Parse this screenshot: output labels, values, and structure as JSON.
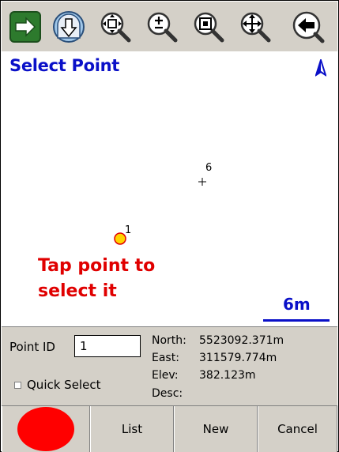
{
  "toolbar": {
    "buttons": [
      {
        "name": "next-arrow-icon",
        "color": "#2d7a2d"
      },
      {
        "name": "download-icon"
      },
      {
        "name": "zoom-extents-icon"
      },
      {
        "name": "zoom-in-out-icon"
      },
      {
        "name": "zoom-window-icon"
      },
      {
        "name": "pan-icon"
      },
      {
        "name": "back-arrow-icon"
      }
    ]
  },
  "map": {
    "title": "Select Point",
    "north_icon": "north-arrow-icon",
    "points": [
      {
        "id": "6",
        "marker": "cross"
      },
      {
        "id": "1",
        "marker": "circle",
        "fill": "#ffd400",
        "stroke": "#e00000"
      }
    ],
    "hint": "Tap point to select it",
    "scale": "6m",
    "colors": {
      "title": "#0a10c8",
      "hint": "#e00000",
      "scale": "#0a10c8"
    }
  },
  "info": {
    "point_id_label": "Point ID",
    "point_id_value": "1",
    "quick_select_label": "Quick Select",
    "north_label": "North:",
    "north_value": "5523092.371m",
    "east_label": "East:",
    "east_value": "311579.774m",
    "elev_label": "Elev:",
    "elev_value": "382.123m",
    "desc_label": "Desc:",
    "desc_value": ""
  },
  "buttons": {
    "record_color": "#ff0000",
    "list_label": "List",
    "new_label": "New",
    "cancel_label": "Cancel"
  }
}
